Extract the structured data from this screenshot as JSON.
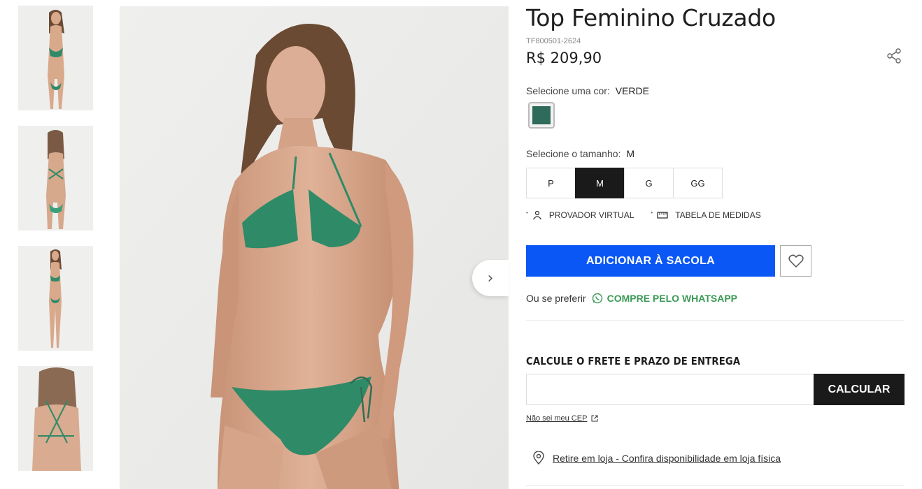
{
  "thumbnails": [
    {
      "alt": "model-front"
    },
    {
      "alt": "model-back"
    },
    {
      "alt": "model-side"
    },
    {
      "alt": "model-back-closeup"
    }
  ],
  "product": {
    "title": "Top Feminino Cruzado",
    "sku": "TF800501-2624",
    "price": "R$ 209,90"
  },
  "color": {
    "label": "Selecione uma cor:",
    "selected": "VERDE",
    "swatch_hex": "#2f6b5a"
  },
  "size": {
    "label": "Selecione o tamanho:",
    "selected": "M",
    "options": [
      "P",
      "M",
      "G",
      "GG"
    ]
  },
  "tools": {
    "virtual": "PROVADOR VIRTUAL",
    "measures": "TABELA DE MEDIDAS"
  },
  "actions": {
    "add_to_bag": "ADICIONAR À SACOLA"
  },
  "whatsapp": {
    "prefix": "Ou se preferir",
    "link": "COMPRE PELO WHATSAPP"
  },
  "shipping": {
    "title": "CALCULE O FRETE E PRAZO DE ENTREGA",
    "input_value": "",
    "calc_label": "CALCULAR",
    "dont_know_cep": "Não sei meu CEP"
  },
  "pickup": {
    "text": "Retire em loja - Confira disponibilidade em loja física"
  },
  "colors": {
    "primary_button": "#0a57f5",
    "whatsapp_green": "#3a9a55",
    "dark": "#1a1a1a",
    "bikini_green": "#2f8a68"
  }
}
